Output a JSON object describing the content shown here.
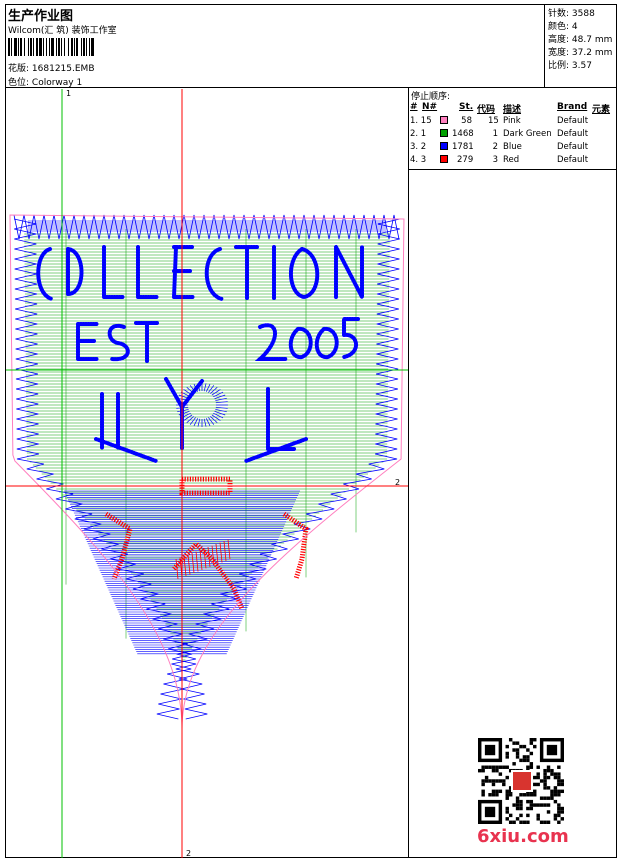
{
  "header": {
    "title": "生产作业图",
    "studio": "Wilcom(汇 筑) 装饰工作室",
    "design_label": "花版:",
    "design_file": "1681215.EMB",
    "colorway_label": "色位:",
    "colorway": "Colorway 1"
  },
  "stats": [
    {
      "label": "针数:",
      "value": "3588"
    },
    {
      "label": "颜色:",
      "value": "4"
    },
    {
      "label": "高度:",
      "value": "48.7 mm"
    },
    {
      "label": "宽度:",
      "value": "37.2 mm"
    },
    {
      "label": "比例:",
      "value": "3.57"
    }
  ],
  "sequence": {
    "title": "停止顺序:",
    "headers": {
      "num": "#",
      "n": "N#",
      "st": "St.",
      "code": "代码",
      "desc": "描述",
      "brand": "Brand",
      "element": "元素"
    },
    "rows": [
      {
        "idx": "1. 15",
        "color": "#ff7fbf",
        "st": "58",
        "code": "15",
        "desc": "Pink",
        "brand": "Default"
      },
      {
        "idx": "2. 1",
        "color": "#00a000",
        "st": "1468",
        "code": "1",
        "desc": "Dark Green",
        "brand": "Default"
      },
      {
        "idx": "3. 2",
        "color": "#0000ff",
        "st": "1781",
        "code": "2",
        "desc": "Blue",
        "brand": "Default"
      },
      {
        "idx": "4. 3",
        "color": "#ff0000",
        "st": "279",
        "code": "3",
        "desc": "Red",
        "brand": "Default"
      }
    ]
  },
  "axes": {
    "v1_label": "1",
    "h2_label": "2",
    "v2_label": "2"
  },
  "watermark": "6xiu.com",
  "colors": {
    "pink": "#ff7fbf",
    "green": "#00a000",
    "blue": "#0000ff",
    "red": "#ff0000"
  }
}
